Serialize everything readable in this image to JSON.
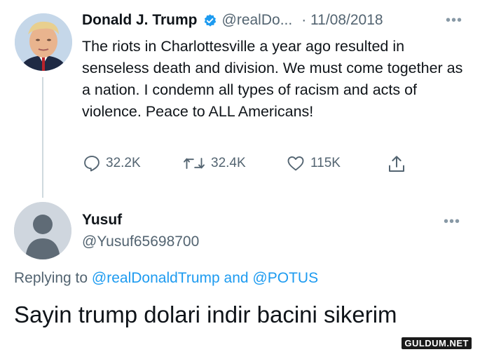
{
  "tweet": {
    "author_name": "Donald J. Trump",
    "verified_icon": "verified-badge-icon",
    "handle": "@realDo...",
    "date": "· 11/08/2018",
    "more_icon": "more-options-icon",
    "text": "The riots in Charlottesville a year ago resulted in senseless death and division. We must come together as a nation. I condemn all types of racism and acts of violence. Peace to ALL Americans!",
    "actions": {
      "reply_count": "32.2K",
      "retweet_count": "32.4K",
      "like_count": "115K"
    }
  },
  "reply": {
    "author_name": "Yusuf",
    "handle": "@Yusuf65698700",
    "replying_prefix": "Replying to",
    "replying_user1": "@realDonaldTrump",
    "replying_and": "and",
    "replying_user2": "@POTUS",
    "text": "Sayin trump dolari indir bacini sikerim"
  },
  "watermark": "GULDUM.NET",
  "colors": {
    "accent": "#1d9bf0",
    "secondary_text": "#536471",
    "primary_text": "#0f1419"
  }
}
